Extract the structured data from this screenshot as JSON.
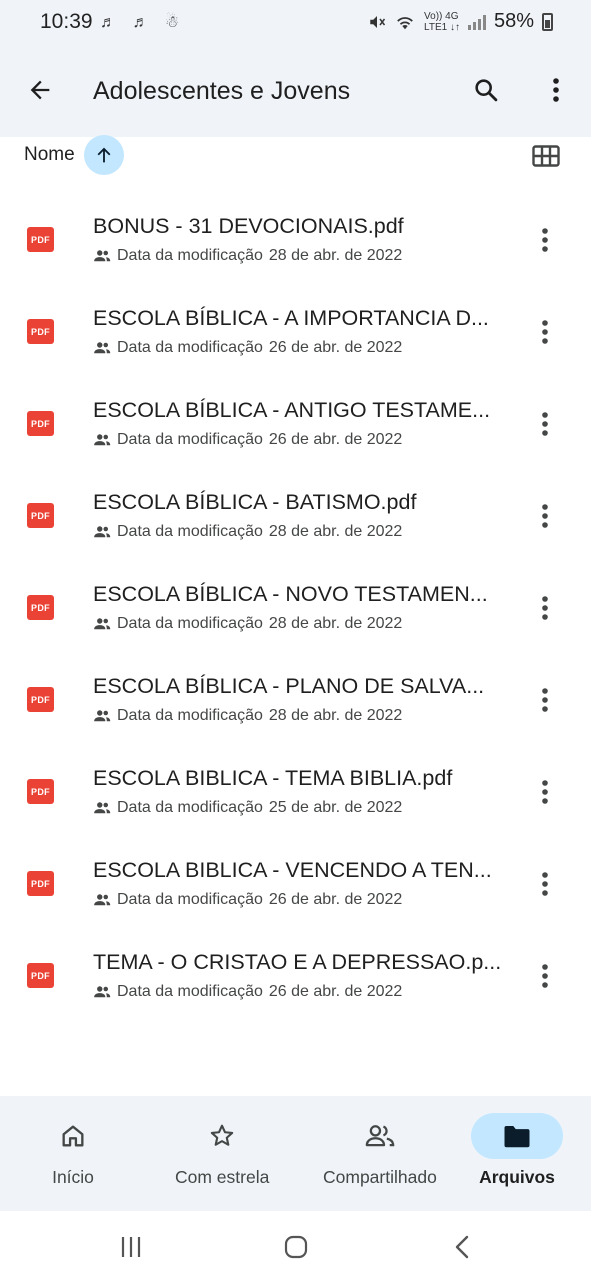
{
  "status_bar": {
    "time": "10:39",
    "left_icons": "♬ ♬ ☃",
    "network_label_top": "Vo)) 4G",
    "network_label_bottom": "LTE1 ↓↑",
    "battery_percent": "58%"
  },
  "app_bar": {
    "title": "Adolescentes e Jovens"
  },
  "sort": {
    "label": "Nome"
  },
  "files": [
    {
      "badge": "PDF",
      "name": "BONUS - 31 DEVOCIONAIS.pdf",
      "meta_label": "Data da modificação",
      "date": "28 de abr. de 2022"
    },
    {
      "badge": "PDF",
      "name": "ESCOLA BÍBLICA - A IMPORTANCIA D...",
      "meta_label": "Data da modificação",
      "date": "26 de abr. de 2022"
    },
    {
      "badge": "PDF",
      "name": "ESCOLA BÍBLICA - ANTIGO TESTAME...",
      "meta_label": "Data da modificação",
      "date": "26 de abr. de 2022"
    },
    {
      "badge": "PDF",
      "name": "ESCOLA BÍBLICA - BATISMO.pdf",
      "meta_label": "Data da modificação",
      "date": "28 de abr. de 2022"
    },
    {
      "badge": "PDF",
      "name": "ESCOLA BÍBLICA - NOVO TESTAMEN...",
      "meta_label": "Data da modificação",
      "date": "28 de abr. de 2022"
    },
    {
      "badge": "PDF",
      "name": "ESCOLA BÍBLICA - PLANO DE SALVA...",
      "meta_label": "Data da modificação",
      "date": "28 de abr. de 2022"
    },
    {
      "badge": "PDF",
      "name": "ESCOLA BIBLICA - TEMA BIBLIA.pdf",
      "meta_label": "Data da modificação",
      "date": "25 de abr. de 2022"
    },
    {
      "badge": "PDF",
      "name": "ESCOLA BIBLICA - VENCENDO A TEN...",
      "meta_label": "Data da modificação",
      "date": "26 de abr. de 2022"
    },
    {
      "badge": "PDF",
      "name": "TEMA - O CRISTAO E A DEPRESSAO.p...",
      "meta_label": "Data da modificação",
      "date": "26 de abr. de 2022"
    }
  ],
  "bottom_nav": {
    "items": [
      {
        "label": "Início",
        "icon": "home-icon",
        "active": false
      },
      {
        "label": "Com estrela",
        "icon": "star-icon",
        "active": false
      },
      {
        "label": "Compartilhado",
        "icon": "people-icon",
        "active": false
      },
      {
        "label": "Arquivos",
        "icon": "folder-icon",
        "active": true
      }
    ]
  },
  "colors": {
    "surface": "#f0f4f9",
    "accent_container": "#c2e7ff",
    "pdf_red": "#ea4335"
  }
}
